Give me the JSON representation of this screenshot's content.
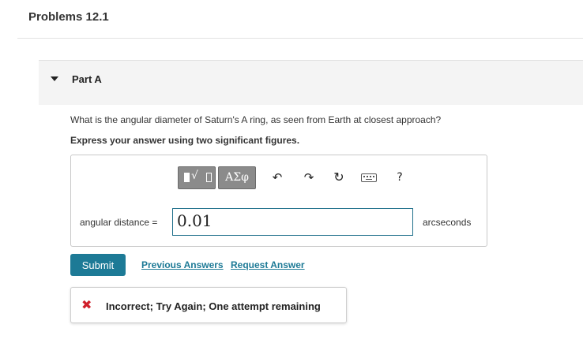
{
  "page": {
    "title": "Problems 12.1"
  },
  "part": {
    "label": "Part A"
  },
  "question": {
    "text": "What is the angular diameter of Saturn's A ring, as seen from Earth at closest approach?",
    "instruction": "Express your answer using two significant figures."
  },
  "toolbar": {
    "greek_label": "ΑΣφ",
    "radical_symbol": "√",
    "undo_icon": "↶",
    "redo_icon": "↷",
    "reset_icon": "↻",
    "help_label": "?",
    "icons": [
      "templates-icon",
      "greek-symbols-icon",
      "undo-icon",
      "redo-icon",
      "reset-icon",
      "keyboard-icon",
      "help-icon"
    ]
  },
  "answer": {
    "label": "angular distance =",
    "value": "0.01",
    "units": "arcseconds"
  },
  "actions": {
    "submit_label": "Submit",
    "previous_answers_label": "Previous Answers",
    "request_answer_label": "Request Answer"
  },
  "feedback": {
    "icon_glyph": "✖",
    "text": "Incorrect; Try Again; One attempt remaining"
  },
  "colors": {
    "accent": "#1d7a96",
    "error": "#d0202b",
    "toolbar_button": "#8b8b8b"
  }
}
